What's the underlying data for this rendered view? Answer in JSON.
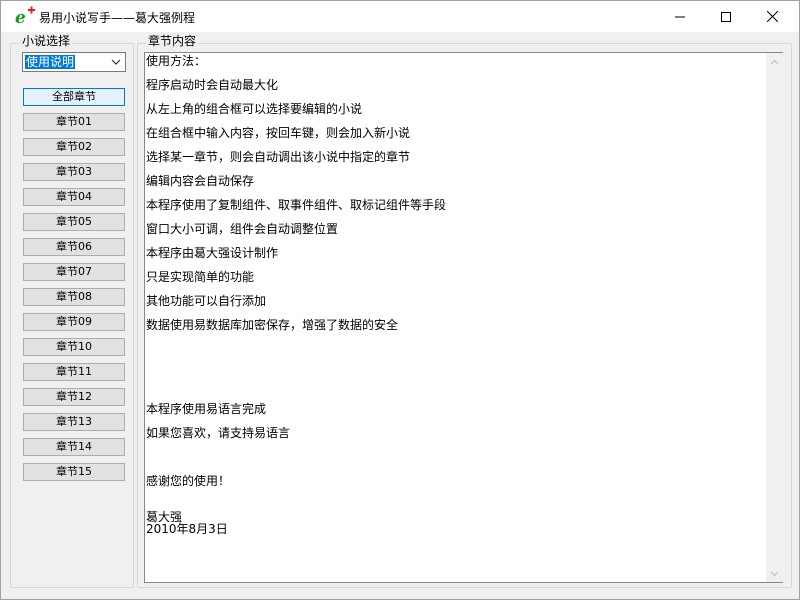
{
  "window": {
    "title": "易用小说写手——葛大强例程"
  },
  "left_panel": {
    "group_label": "小说选择",
    "combo_value": "使用说明",
    "all_chapters_label": "全部章节",
    "chapters": [
      "章节01",
      "章节02",
      "章节03",
      "章节04",
      "章节05",
      "章节06",
      "章节07",
      "章节08",
      "章节09",
      "章节10",
      "章节11",
      "章节12",
      "章节13",
      "章节14",
      "章节15"
    ]
  },
  "right_panel": {
    "group_label": "章节内容",
    "lines": [
      "使用方法：",
      "程序启动时会自动最大化",
      "从左上角的组合框可以选择要编辑的小说",
      "在组合框中输入内容，按回车键，则会加入新小说",
      "选择某一章节，则会自动调出该小说中指定的章节",
      "编辑内容会自动保存",
      "本程序使用了复制组件、取事件组件、取标记组件等手段",
      "窗口大小可调，组件会自动调整位置",
      "本程序由葛大强设计制作",
      "只是实现简单的功能",
      "其他功能可以自行添加",
      "数据使用易数据库加密保存，增强了数据的安全",
      "本程序使用易语言完成",
      "如果您喜欢，请支持易语言",
      "感谢您的使用！",
      "葛大强",
      "2010年8月3日"
    ]
  },
  "colors": {
    "selection": "#0078d7",
    "active_border": "#0078d7",
    "window_bg": "#f0f0f0"
  }
}
